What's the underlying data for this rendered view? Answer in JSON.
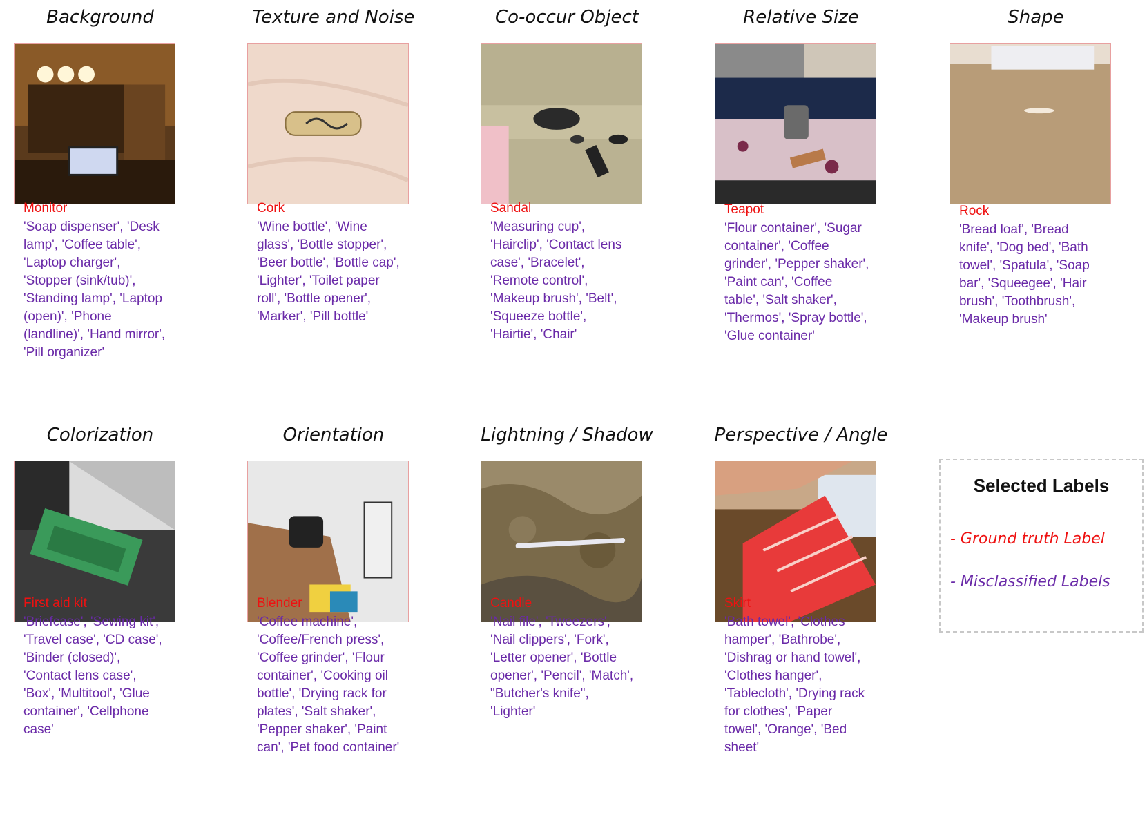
{
  "panels": [
    {
      "title": "Background",
      "ground_truth": "Monitor",
      "misclassified": "'Soap dispenser', 'Desk lamp', 'Coffee table', 'Laptop charger', 'Stopper (sink/tub)', 'Standing lamp', 'Laptop (open)', 'Phone (landline)', 'Hand mirror', 'Pill organizer'"
    },
    {
      "title": "Texture and Noise",
      "ground_truth": "Cork",
      "misclassified": "'Wine bottle', 'Wine glass', 'Bottle stopper', 'Beer bottle', 'Bottle cap', 'Lighter', 'Toilet paper roll', 'Bottle opener', 'Marker', 'Pill bottle'"
    },
    {
      "title": "Co-occur Object",
      "ground_truth": "Sandal",
      "misclassified": "'Measuring cup', 'Hairclip', 'Contact lens case', 'Bracelet', 'Remote control', 'Makeup brush', 'Belt', 'Squeeze bottle', 'Hairtie', 'Chair'"
    },
    {
      "title": "Relative Size",
      "ground_truth": "Teapot",
      "misclassified": "'Flour container', 'Sugar container', 'Coffee grinder', 'Pepper shaker', 'Paint can', 'Coffee table', 'Salt shaker', 'Thermos', 'Spray bottle', 'Glue container'"
    },
    {
      "title": "Shape",
      "ground_truth": "Rock",
      "misclassified": "'Bread loaf', 'Bread knife', 'Dog bed', 'Bath towel', 'Spatula', 'Soap bar', 'Squeegee', 'Hair brush', 'Toothbrush', 'Makeup brush'"
    },
    {
      "title": "Colorization",
      "ground_truth": "First aid kit",
      "misclassified": "'Briefcase', 'Sewing kit', 'Travel case', 'CD case', 'Binder (closed)', 'Contact lens case', 'Box', 'Multitool', 'Glue container', 'Cellphone case'"
    },
    {
      "title": "Orientation",
      "ground_truth": "Blender",
      "misclassified": "'Coffee machine', 'Coffee/French press', 'Coffee grinder', 'Flour container', 'Cooking oil bottle', 'Drying rack for plates', 'Salt shaker', 'Pepper shaker', 'Paint can', 'Pet food container'"
    },
    {
      "title": "Lightning / Shadow",
      "ground_truth": "Candle",
      "misclassified": "'Nail file', 'Tweezers', 'Nail clippers', 'Fork', 'Letter opener', 'Bottle opener', 'Pencil', 'Match', \"Butcher's knife\", 'Lighter'"
    },
    {
      "title": "Perspective / Angle",
      "ground_truth": "Skirt",
      "misclassified": "'Bath towel', 'Clothes hamper', 'Bathrobe', 'Dishrag or hand towel', 'Clothes hanger', 'Tablecloth', 'Drying rack for clothes', 'Paper towel', 'Orange', 'Bed sheet'"
    }
  ],
  "legend": {
    "title": "Selected Labels",
    "ground_truth_label": "- Ground truth Label",
    "misclassified_label": "- Misclassified Labels",
    "ground_truth_color": "#ee1111",
    "misclassified_color": "#6a2aa8"
  }
}
